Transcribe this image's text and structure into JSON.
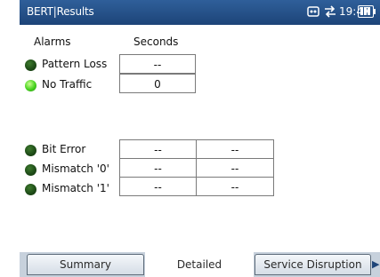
{
  "titlebar": {
    "title": "BERT|Results",
    "remote_icon": "remote-control-icon",
    "transfer_icon": "transfer-arrows-icon",
    "time": "19:47",
    "battery_icon": "battery-full-icon"
  },
  "table": {
    "header_alarms": "Alarms",
    "header_seconds": "Seconds"
  },
  "alarms": [
    {
      "label": "Pattern Loss",
      "state": "off",
      "values": [
        "--"
      ]
    },
    {
      "label": "No Traffic",
      "state": "on",
      "values": [
        "0"
      ]
    },
    {
      "label": "Bit Error",
      "state": "off",
      "values": [
        "--",
        "--"
      ]
    },
    {
      "label": "Mismatch '0'",
      "state": "off",
      "values": [
        "--",
        "--"
      ]
    },
    {
      "label": "Mismatch '1'",
      "state": "off",
      "values": [
        "--",
        "--"
      ]
    }
  ],
  "tabs": [
    {
      "label": "Summary"
    },
    {
      "label": "Detailed"
    },
    {
      "label": "Service Disruption"
    }
  ],
  "colors": {
    "titlebar": "#1d4478",
    "led_on": "#46d21e",
    "led_off": "#1f4d18",
    "tabbar": "#c7d1dc"
  }
}
